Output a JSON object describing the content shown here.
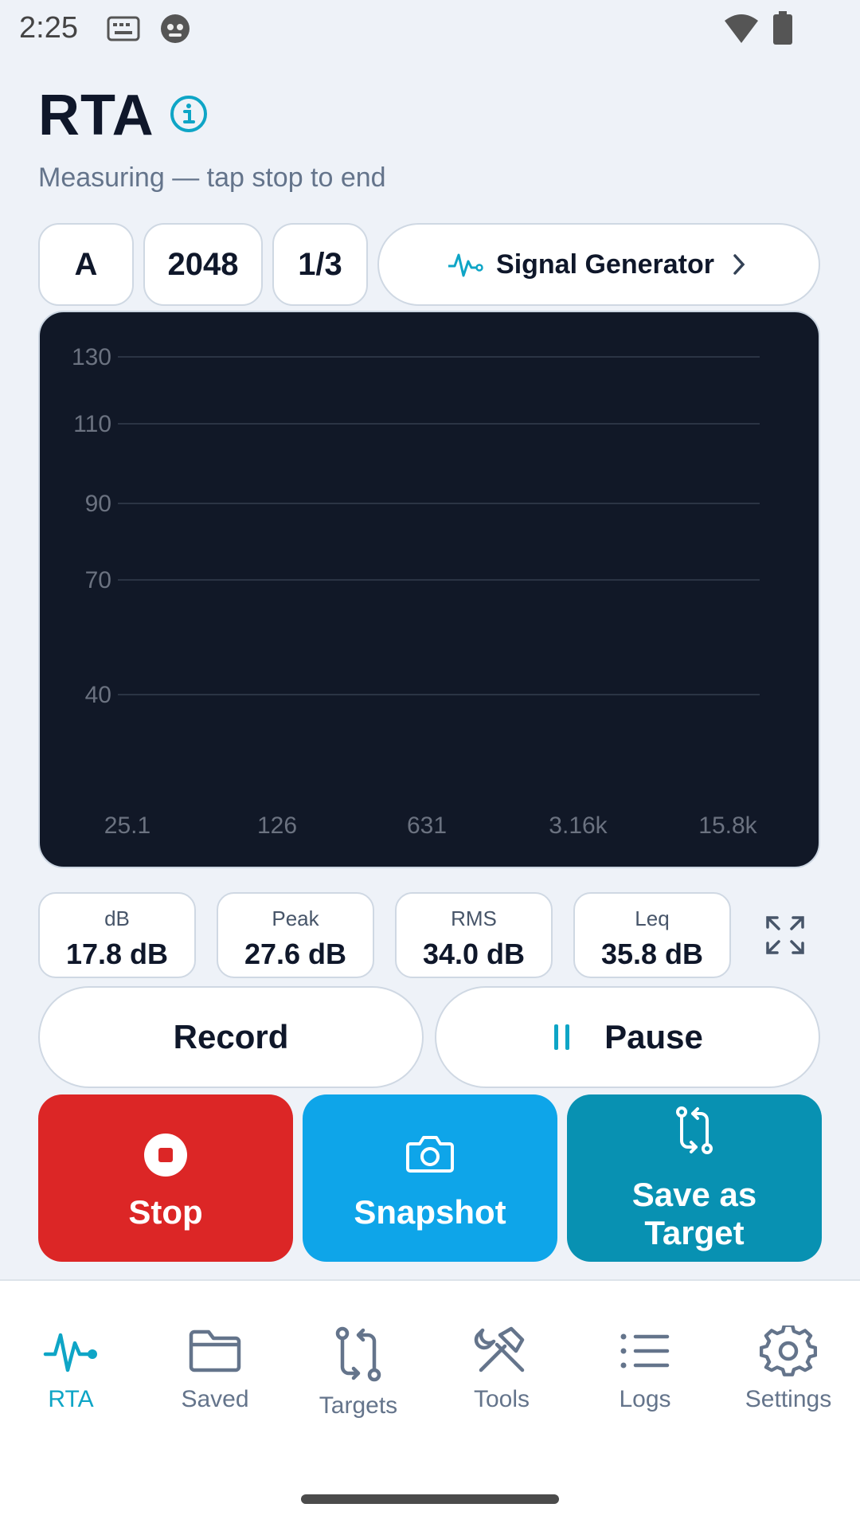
{
  "status_bar": {
    "time": "2:25"
  },
  "header": {
    "title": "RTA",
    "subtitle": "Measuring — tap stop to end"
  },
  "chips": {
    "weighting": "A",
    "fft_size": "2048",
    "octave": "1/3",
    "signal_generator": "Signal Generator"
  },
  "chart_data": {
    "type": "line",
    "title": "",
    "xlabel": "",
    "ylabel": "",
    "x_scale": "log",
    "x_tick_labels": [
      "25.1",
      "126",
      "631",
      "3.16k",
      "15.8k"
    ],
    "y_ticks": [
      130,
      110,
      90,
      70,
      40
    ],
    "series": [],
    "grid": true
  },
  "metrics": [
    {
      "label": "dB",
      "value": "17.8 dB"
    },
    {
      "label": "Peak",
      "value": "27.6 dB"
    },
    {
      "label": "RMS",
      "value": "34.0 dB"
    },
    {
      "label": "Leq",
      "value": "35.8 dB"
    }
  ],
  "controls": {
    "record": "Record",
    "pause": "Pause"
  },
  "actions": {
    "stop": "Stop",
    "snapshot": "Snapshot",
    "save_target_1": "Save as",
    "save_target_2": "Target"
  },
  "colors": {
    "accent": "#0ea5c6",
    "stop": "#dc2626",
    "snapshot": "#0ea5e9",
    "save_target": "#0891b2",
    "chart_bg": "#111827"
  },
  "nav": [
    {
      "label": "RTA",
      "icon": "pulse-icon",
      "active": true
    },
    {
      "label": "Saved",
      "icon": "folder-icon"
    },
    {
      "label": "Targets",
      "icon": "compare-icon"
    },
    {
      "label": "Tools",
      "icon": "tools-icon"
    },
    {
      "label": "Logs",
      "icon": "list-icon"
    },
    {
      "label": "Settings",
      "icon": "gear-icon"
    }
  ]
}
